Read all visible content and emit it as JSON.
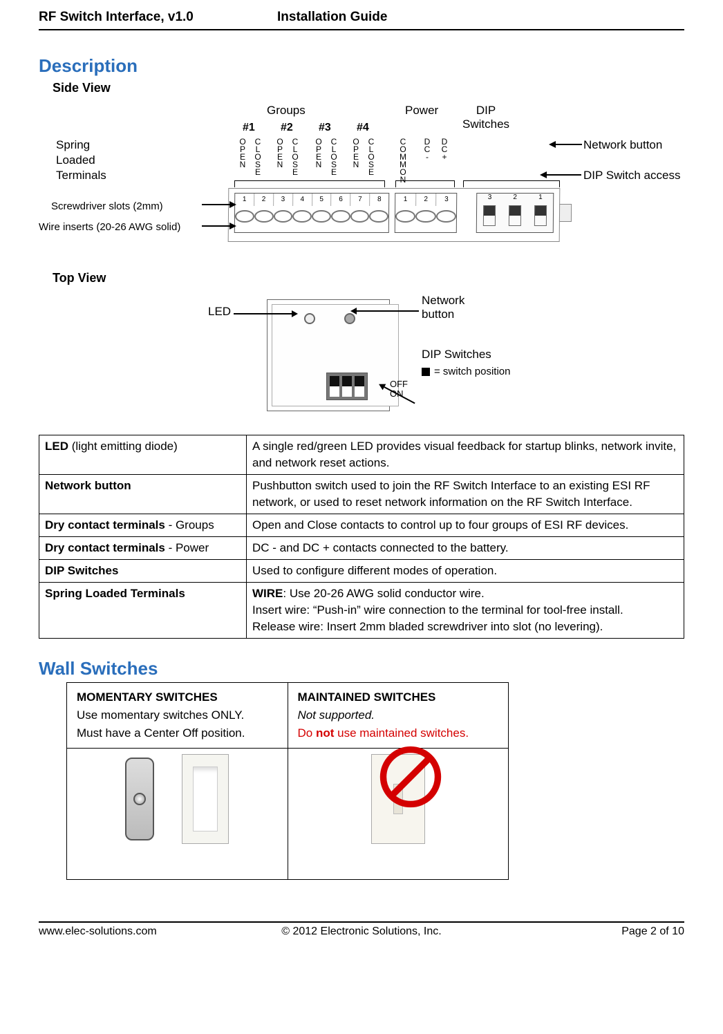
{
  "header": {
    "left": "RF Switch Interface, v1.0",
    "center": "Installation Guide"
  },
  "sections": {
    "description": "Description",
    "side_view": "Side View",
    "top_view": "Top View",
    "wall_switches": "Wall Switches"
  },
  "side_view": {
    "groups_label": "Groups",
    "power_label": "Power",
    "dip_label": "DIP\nSwitches",
    "group_nums": [
      "#1",
      "#2",
      "#3",
      "#4"
    ],
    "vert_open": "OPEN",
    "vert_close": "CLOSE",
    "vert_common": "COMMON",
    "vert_dc_minus": "DC-",
    "vert_dc_plus": "DC+",
    "terminal1_nums": [
      "1",
      "2",
      "3",
      "4",
      "5",
      "6",
      "7",
      "8"
    ],
    "terminal2_nums": [
      "1",
      "2",
      "3"
    ],
    "dip_nums": [
      "3",
      "2",
      "1"
    ],
    "spring_label": "Spring\nLoaded\nTerminals",
    "screw_label": "Screwdriver slots (2mm)",
    "wire_label": "Wire inserts (20-26 AWG solid)",
    "network_btn": "Network button",
    "dip_access": "DIP Switch access"
  },
  "top_view": {
    "led": "LED",
    "network_btn": "Network\nbutton",
    "dip_sw": "DIP Switches",
    "sw_pos": "= switch position",
    "off": "OFF",
    "on": "ON"
  },
  "desc_table": [
    {
      "term_b": "LED",
      "term_rest": " (light emitting diode)",
      "desc": "A single red/green LED provides visual feedback for startup blinks, network invite, and network reset actions."
    },
    {
      "term_b": "Network button",
      "term_rest": "",
      "desc": "Pushbutton switch used to join the RF Switch Interface to an existing ESI RF network, or used to reset network information on the RF Switch Interface."
    },
    {
      "term_b": "Dry contact terminals",
      "term_rest": " - Groups",
      "desc": "Open and Close contacts to control up to four groups of ESI RF devices."
    },
    {
      "term_b": "Dry contact terminals",
      "term_rest": " - Power",
      "desc": "DC - and DC + contacts connected to the battery."
    },
    {
      "term_b": "DIP Switches",
      "term_rest": "",
      "desc": "Used to configure different modes of operation."
    },
    {
      "term_b": "Spring Loaded Terminals",
      "term_rest": "",
      "desc_lines": [
        {
          "b": "WIRE",
          "rest": ": Use 20-26 AWG solid conductor wire."
        },
        {
          "plain": "Insert wire: “Push-in” wire connection to the terminal for tool-free install."
        },
        {
          "plain": "Release wire: Insert 2mm bladed screwdriver into slot (no levering)."
        }
      ]
    }
  ],
  "wall": {
    "mom_h": "MOMENTARY SWITCHES",
    "mom_l1": "Use momentary switches ONLY.",
    "mom_l2": "Must have a Center Off position.",
    "mnt_h": "MAINTAINED SWITCHES",
    "mnt_l1": "Not supported.",
    "mnt_warn_pre": "Do ",
    "mnt_warn_b": "not",
    "mnt_warn_post": " use maintained switches."
  },
  "footer": {
    "left": "www.elec-solutions.com",
    "center": "© 2012 Electronic Solutions, Inc.",
    "right": "Page 2 of 10"
  }
}
